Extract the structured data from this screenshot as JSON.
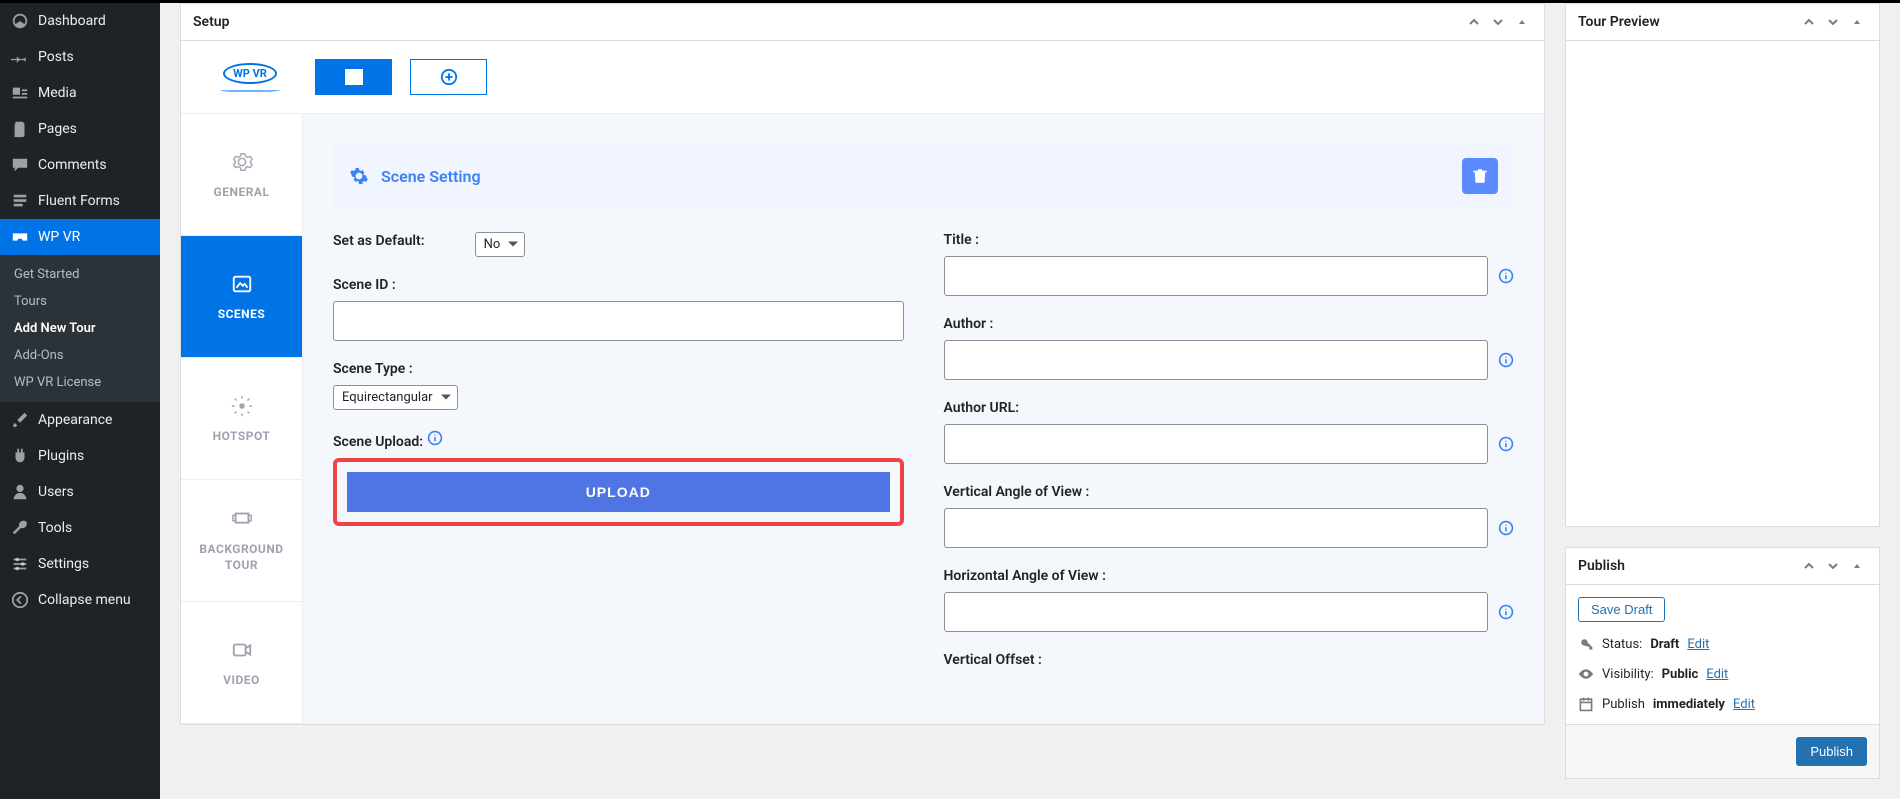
{
  "sidebar": {
    "items": [
      {
        "label": "Dashboard"
      },
      {
        "label": "Posts"
      },
      {
        "label": "Media"
      },
      {
        "label": "Pages"
      },
      {
        "label": "Comments"
      },
      {
        "label": "Fluent Forms"
      },
      {
        "label": "WP VR"
      },
      {
        "label": "Appearance"
      },
      {
        "label": "Plugins"
      },
      {
        "label": "Users"
      },
      {
        "label": "Tools"
      },
      {
        "label": "Settings"
      },
      {
        "label": "Collapse menu"
      }
    ],
    "submenu": [
      {
        "label": "Get Started"
      },
      {
        "label": "Tours"
      },
      {
        "label": "Add New Tour"
      },
      {
        "label": "Add-Ons"
      },
      {
        "label": "WP VR License"
      }
    ]
  },
  "setup": {
    "title": "Setup",
    "logo_text": "WP VR",
    "vtabs": {
      "general": "GENERAL",
      "scenes": "SCENES",
      "hotspot": "HOTSPOT",
      "bgtour": "BACKGROUND\nTOUR",
      "video": "VIDEO"
    },
    "scene_head": "Scene Setting",
    "labels": {
      "set_default": "Set as Default:",
      "scene_id": "Scene ID :",
      "scene_type": "Scene Type :",
      "scene_upload": "Scene Upload:",
      "title": "Title :",
      "author": "Author :",
      "author_url": "Author URL:",
      "vfov": "Vertical Angle of View :",
      "hfov": "Horizontal Angle of View :",
      "voffset": "Vertical Offset :"
    },
    "values": {
      "set_default": "No",
      "scene_type": "Equirectangular",
      "upload_btn": "UPLOAD"
    }
  },
  "preview": {
    "title": "Tour Preview"
  },
  "publish": {
    "title": "Publish",
    "save_draft": "Save Draft",
    "status_label": "Status:",
    "status_value": "Draft",
    "vis_label": "Visibility:",
    "vis_value": "Public",
    "pub_label": "Publish",
    "pub_value": "immediately",
    "edit": "Edit",
    "button": "Publish"
  }
}
